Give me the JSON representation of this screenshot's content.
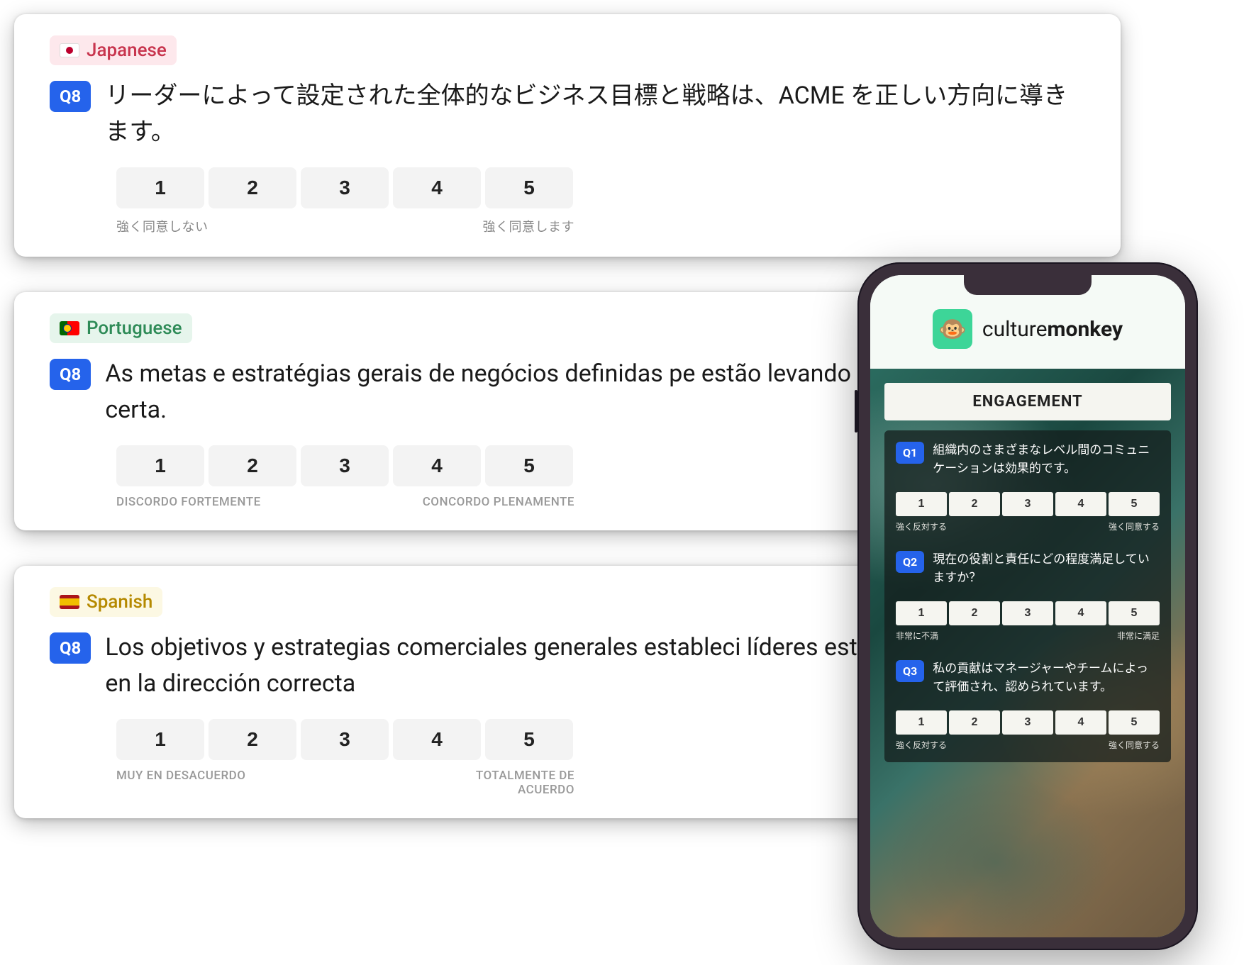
{
  "cards": [
    {
      "lang_label": "Japanese",
      "q_id": "Q8",
      "question": "リーダーによって設定された全体的なビジネス目標と戦略は、ACME を正しい方向に導きます。",
      "scale": [
        "1",
        "2",
        "3",
        "4",
        "5"
      ],
      "left_label": "強く同意しない",
      "right_label": "強く同意します"
    },
    {
      "lang_label": "Portuguese",
      "q_id": "Q8",
      "question": "As metas e estratégias gerais de negócios definidas pe estão levando a ACME na direção certa.",
      "scale": [
        "1",
        "2",
        "3",
        "4",
        "5"
      ],
      "left_label": "DISCORDO FORTEMENTE",
      "right_label": "CONCORDO PLENAMENTE"
    },
    {
      "lang_label": "Spanish",
      "q_id": "Q8",
      "question": "Los objetivos y estrategias comerciales generales estableci líderes están llevando a ACME en la dirección correcta",
      "scale": [
        "1",
        "2",
        "3",
        "4",
        "5"
      ],
      "left_label": "MUY EN DESACUERDO",
      "right_label": "TOTALMENTE DE ACUERDO"
    }
  ],
  "phone": {
    "brand_a": "culture",
    "brand_b": "monkey",
    "section": "ENGAGEMENT",
    "questions": [
      {
        "id": "Q1",
        "text": "組織内のさまざまなレベル間のコミュニケーションは効果的です。",
        "scale": [
          "1",
          "2",
          "3",
          "4",
          "5"
        ],
        "left": "強く反対する",
        "right": "強く同意する"
      },
      {
        "id": "Q2",
        "text": "現在の役割と責任にどの程度満足していますか？",
        "scale": [
          "1",
          "2",
          "3",
          "4",
          "5"
        ],
        "left": "非常に不満",
        "right": "非常に満足"
      },
      {
        "id": "Q3",
        "text": "私の貢献はマネージャーやチームによって評価され、認められています。",
        "scale": [
          "1",
          "2",
          "3",
          "4",
          "5"
        ],
        "left": "強く反対する",
        "right": "強く同意する"
      }
    ]
  }
}
